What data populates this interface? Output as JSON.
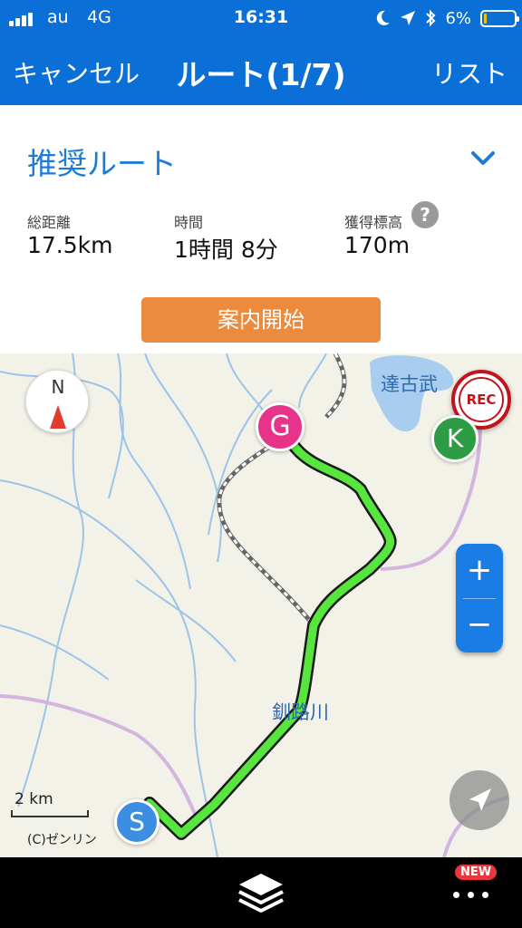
{
  "status": {
    "carrier": "au",
    "network": "4G",
    "time": "16:31",
    "battery": "6%",
    "battery_level": 0.06,
    "icons": [
      "moon-icon",
      "location-arrow-icon",
      "bluetooth-icon"
    ]
  },
  "nav": {
    "cancel_label": "キャンセル",
    "title": "ルート(1/7)",
    "list_label": "リスト"
  },
  "route": {
    "name": "推奨ルート",
    "stats": {
      "distance_label": "総距離",
      "distance_value": "17.5km",
      "time_label": "時間",
      "time_value": "1時間 8分",
      "elevation_label": "獲得標高",
      "elevation_value": "170m"
    },
    "help_label": "?",
    "start_label": "案内開始"
  },
  "map": {
    "compass_label": "N",
    "rec_label": "REC",
    "zoom_in": "+",
    "zoom_out": "−",
    "place_lake": "達古武",
    "place_river": "釧路川",
    "scale": "2 km",
    "copyright": "(C)ゼンリン",
    "markers": {
      "start": "S",
      "goal": "G",
      "k": "K"
    },
    "colors": {
      "route": "#57e63d",
      "goal": "#e8338a",
      "start": "#3b8ee0",
      "k": "#2e9b45"
    }
  },
  "bottom": {
    "badge": "NEW"
  },
  "colors": {
    "primary": "#0a6fd6",
    "accent_link": "#1d7bd8",
    "start_button": "#ec8a3e"
  }
}
